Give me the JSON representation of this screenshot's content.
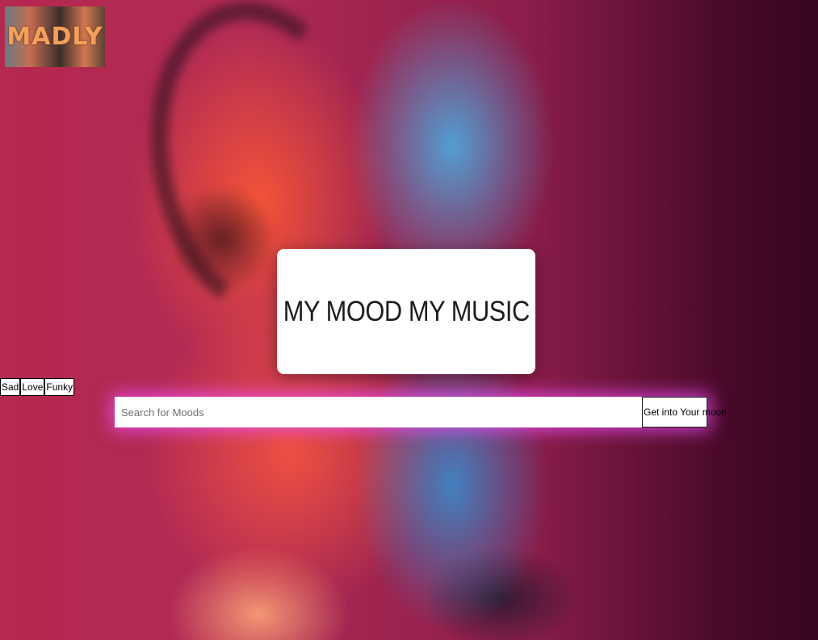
{
  "logo": {
    "text": "MADLY"
  },
  "title_card": {
    "title": "MY MOOD MY MUSIC"
  },
  "mood_buttons": [
    {
      "label": "Sad"
    },
    {
      "label": "Love"
    },
    {
      "label": "Funky"
    }
  ],
  "search": {
    "placeholder": "Search for Moods",
    "value": "",
    "button_label": "Get into Your mood"
  },
  "colors": {
    "background_left": "#b5284f",
    "background_right": "#360520",
    "card_background": "#ffffff",
    "search_glow": "#f050ff"
  },
  "icons": {
    "background_image": "person-with-headphones-photo"
  }
}
